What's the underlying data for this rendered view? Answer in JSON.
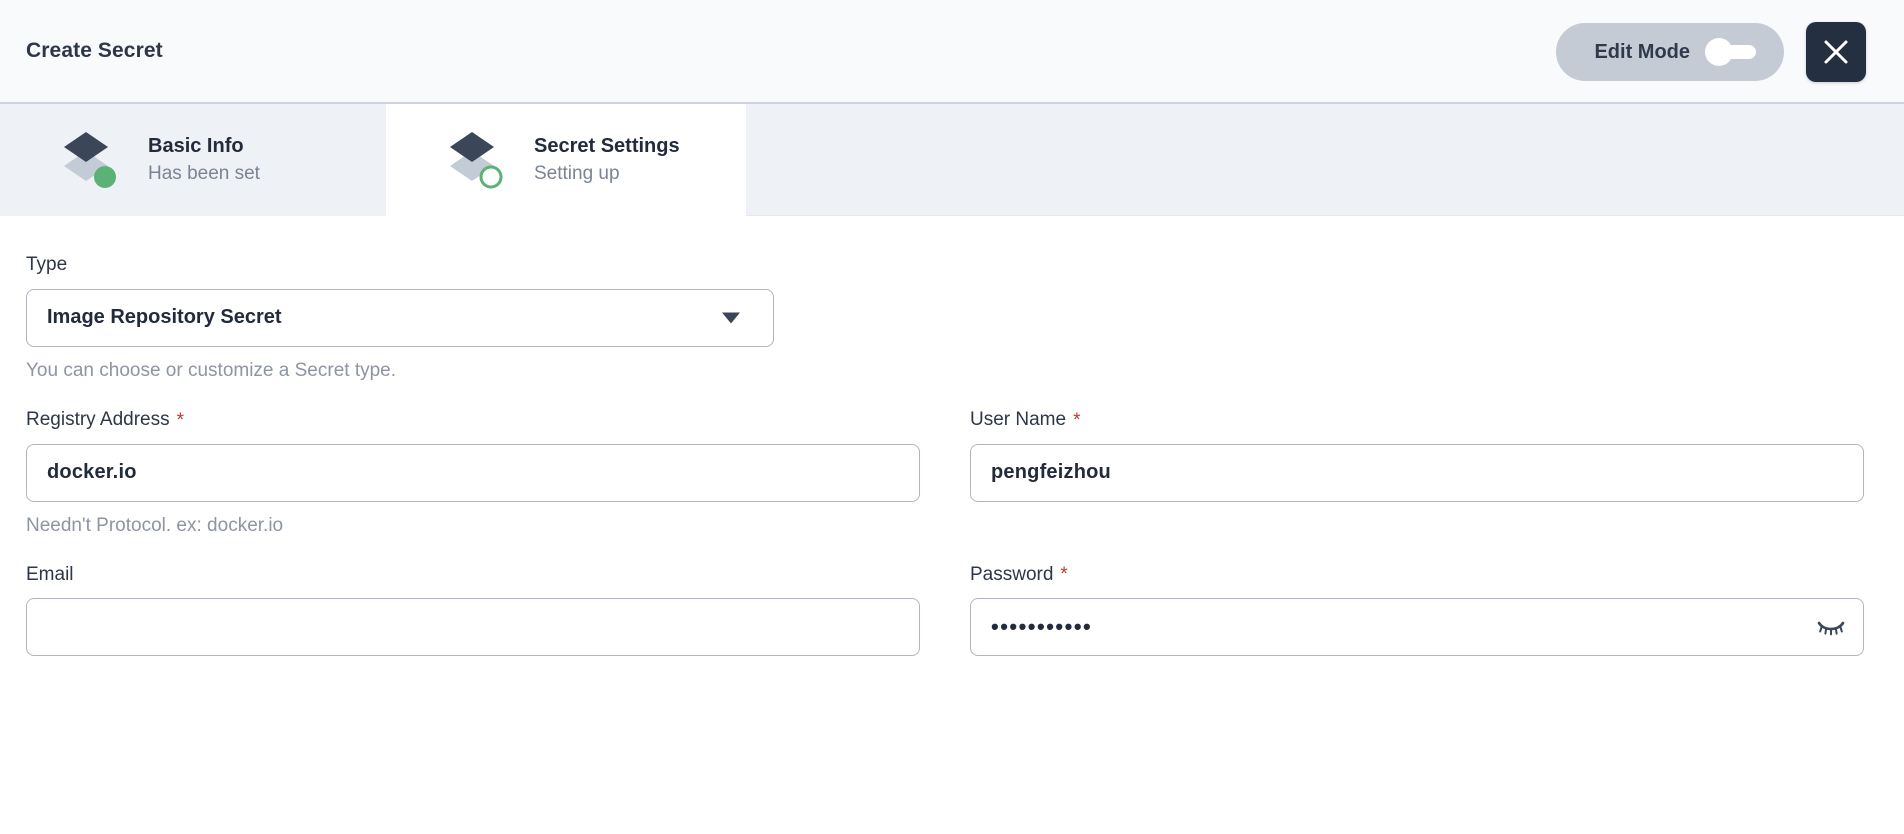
{
  "header": {
    "title": "Create Secret",
    "edit_mode_label": "Edit Mode",
    "edit_mode_enabled": false,
    "close_label": "Close"
  },
  "tabs": [
    {
      "label": "Basic Info",
      "status": "Has been set",
      "state": "complete",
      "active": false
    },
    {
      "label": "Secret Settings",
      "status": "Setting up",
      "state": "in-progress",
      "active": true
    }
  ],
  "form": {
    "type": {
      "label": "Type",
      "value": "Image Repository Secret",
      "hint": "You can choose or customize a Secret type."
    },
    "registry_address": {
      "label": "Registry Address",
      "required": "*",
      "value": "docker.io",
      "placeholder": "",
      "hint": "Needn't Protocol. ex: docker.io"
    },
    "user_name": {
      "label": "User Name",
      "required": "*",
      "value": "pengfeizhou",
      "placeholder": ""
    },
    "email": {
      "label": "Email",
      "value": "",
      "placeholder": ""
    },
    "password": {
      "label": "Password",
      "required": "*",
      "value": "•••••••••••",
      "placeholder": "",
      "masked": true
    }
  },
  "colors": {
    "header_bg": "#f8fafc",
    "tab_inactive_bg": "#eef1f6",
    "tab_active_bg": "#ffffff",
    "accent_dark": "#2d3748",
    "close_button_bg": "#252f42",
    "required_red": "#c0392b",
    "status_green": "#5cb176",
    "diamond_top": "#3b4759",
    "diamond_bottom": "#c3cbd6",
    "border": "#aeb6c4"
  }
}
